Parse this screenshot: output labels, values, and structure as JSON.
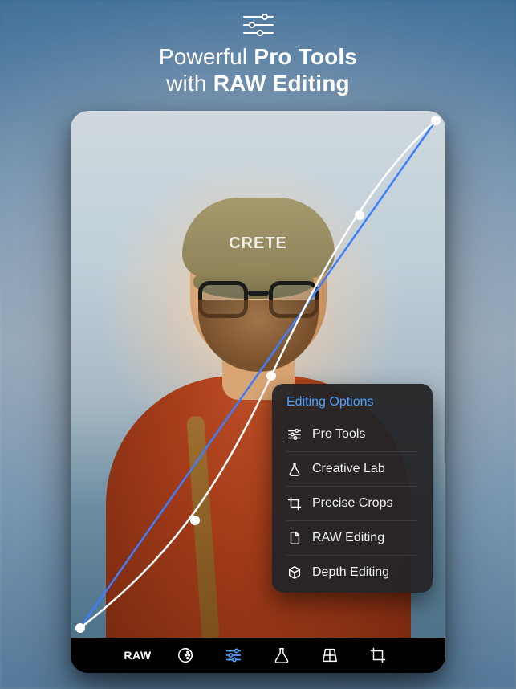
{
  "headline": {
    "line1_a": "Powerful ",
    "line1_b": "Pro Tools",
    "line2_a": "with ",
    "line2_b": "RAW Editing"
  },
  "photo": {
    "cap_text": "CRETE"
  },
  "popover": {
    "title": "Editing Options",
    "items": [
      {
        "icon": "sliders-icon",
        "label": "Pro Tools"
      },
      {
        "icon": "flask-icon",
        "label": "Creative Lab"
      },
      {
        "icon": "crop-icon",
        "label": "Precise Crops"
      },
      {
        "icon": "file-icon",
        "label": "RAW Editing"
      },
      {
        "icon": "cube-icon",
        "label": "Depth Editing"
      }
    ]
  },
  "toolbar": {
    "raw_label": "RAW",
    "items": [
      {
        "name": "raw-button",
        "icon": "text"
      },
      {
        "name": "filters-button",
        "icon": "halftone-icon"
      },
      {
        "name": "adjust-button",
        "icon": "sliders-icon",
        "active": true
      },
      {
        "name": "lab-button",
        "icon": "flask-icon"
      },
      {
        "name": "transform-button",
        "icon": "perspective-icon"
      },
      {
        "name": "crop-button",
        "icon": "crop-icon"
      }
    ]
  },
  "colors": {
    "accent": "#4ea1ff",
    "curve_reference": "#3d7dff",
    "curve_edit": "#ffffff"
  }
}
